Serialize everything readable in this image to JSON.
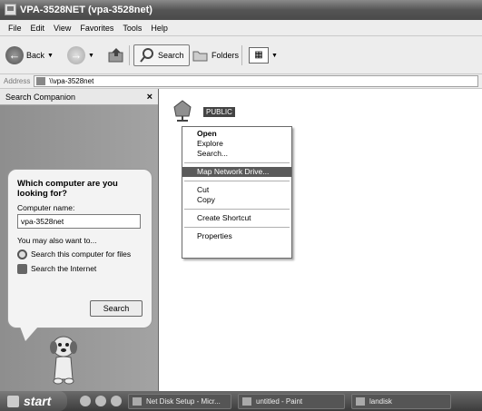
{
  "window": {
    "title": "VPA-3528NET (vpa-3528net)"
  },
  "menu": [
    "File",
    "Edit",
    "View",
    "Favorites",
    "Tools",
    "Help"
  ],
  "toolbar": {
    "back": "Back",
    "search": "Search",
    "folders": "Folders"
  },
  "address": {
    "label": "Address",
    "value": "\\\\vpa-3528net"
  },
  "search_companion": {
    "title": "Search Companion",
    "close": "×",
    "question": "Which computer are you looking for?",
    "computer_name_label": "Computer name:",
    "computer_name_value": "vpa-3528net",
    "also": "You may also want to...",
    "option_computer": "Search this computer for files",
    "option_internet": "Search the Internet",
    "search_button": "Search"
  },
  "content": {
    "share_name": "PUBLIC"
  },
  "context_menu": {
    "open": "Open",
    "explore": "Explore",
    "search": "Search...",
    "map_drive": "Map Network Drive...",
    "cut": "Cut",
    "copy": "Copy",
    "create_shortcut": "Create Shortcut",
    "properties": "Properties"
  },
  "taskbar": {
    "start": "start",
    "tasks": [
      "Net Disk Setup - Micr...",
      "untitled - Paint",
      "landisk"
    ]
  }
}
